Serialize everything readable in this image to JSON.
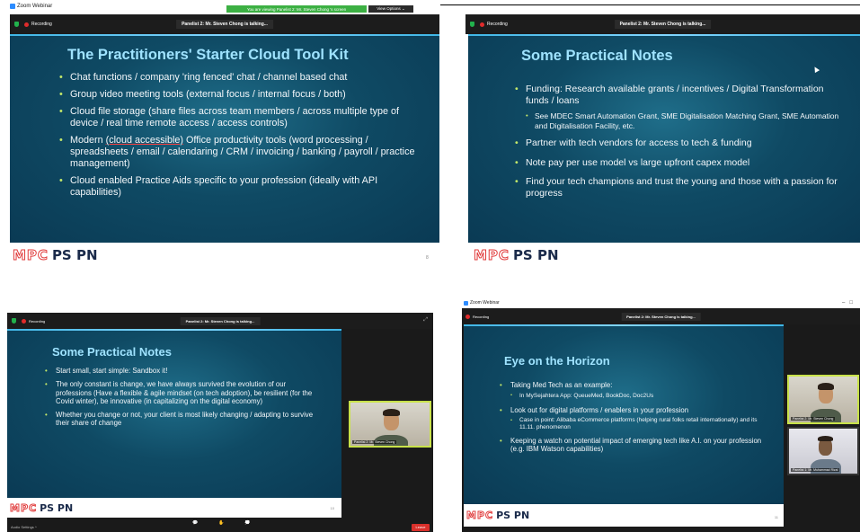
{
  "panel1": {
    "app_title": "Zoom Webinar",
    "viewing_notice": "You are viewing Panelist 2: Mr. Steven Chong 's screen",
    "view_options": "View Options ⌄",
    "recording": "Recording",
    "talking": "Panelist 2: Mr. Steven Chong is talking...",
    "slide_title": "The Practitioners' Starter Cloud Tool Kit",
    "bullets": [
      "Chat functions / company 'ring fenced' chat / channel based chat",
      "Group video meeting tools (external focus / internal focus / both)",
      "Cloud file storage (share files across team members / across multiple type of device / real time remote access / access controls)",
      "Office productivity tools (word processing / spreadsheets / email / calendaring / CRM / invoicing / banking / payroll / practice management)",
      "Cloud enabled Practice Aids specific to your profession (ideally with API capabilities)"
    ],
    "bullet4_prefix": "Modern ",
    "bullet4_underlined": "(cloud accessible)",
    "page_number": "8"
  },
  "panel2": {
    "recording": "Recording",
    "talking": "Panelist 2: Mr. Steven Chong is talking...",
    "slide_title": "Some Practical Notes",
    "bullets": [
      "Funding: Research available grants / incentives / Digital Transformation funds / loans",
      "See MDEC Smart Automation Grant, SME Digitalisation Matching Grant, SME Automation and Digitalisation Facility, etc.",
      "Partner with tech vendors for access to tech & funding",
      "Note pay per use model vs large upfront capex model",
      "Find your tech champions and trust the young and those with a passion for progress"
    ]
  },
  "panel3": {
    "recording": "Recording",
    "talking": "Panelist 2: Mr. Steven Chong is talking...",
    "slide_title": "Some Practical Notes",
    "bullets": [
      "Start small, start simple: Sandbox it!",
      "The only constant is change, we have always survived the evolution of our professions (Have a flexible & agile mindset (on tech adoption), be resilient (for the Covid winter), be innovative (in capitalizing on the digital economy)",
      "Whether you change or not, your client is most likely changing / adapting to survive their share of change"
    ],
    "speaker_name": "Panelist 2: Mr. Steven Chong",
    "page_number": "10",
    "audio_settings": "Audio Settings ^",
    "end_label": "Leave"
  },
  "panel4": {
    "app_title": "Zoom Webinar",
    "recording": "Recording",
    "talking": "Panelist 2: Mr. Steven Chong is talking...",
    "slide_title": "Eye on the Horizon",
    "bullets": [
      "Taking Med Tech as an example:",
      "In MySejahtera App: QueueMed, BookDoc, Doc2Us",
      "Look out for digital platforms / enablers in your profession",
      "Case in point: Alibaba eCommerce platforms (helping rural folks retail internationally) and its 11.11. phenomenon",
      "Keeping a watch on potential impact of emerging tech like A.I. on your profession (e.g. IBM Watson capabilities)"
    ],
    "speaker1_name": "Panelist 2: Mr. Steven Chong",
    "speaker2_name": "Panelist 1: Mr. Muhammad Rizal",
    "page_number": "11",
    "window_controls": "–   □"
  },
  "logo": {
    "mpc": "MPC",
    "pspn": "PS PN"
  },
  "colors": {
    "slide_bg": "#0f4a64",
    "title": "#9fe3ff",
    "bullet": "#c4e86a",
    "recording": "#e02b2b"
  }
}
